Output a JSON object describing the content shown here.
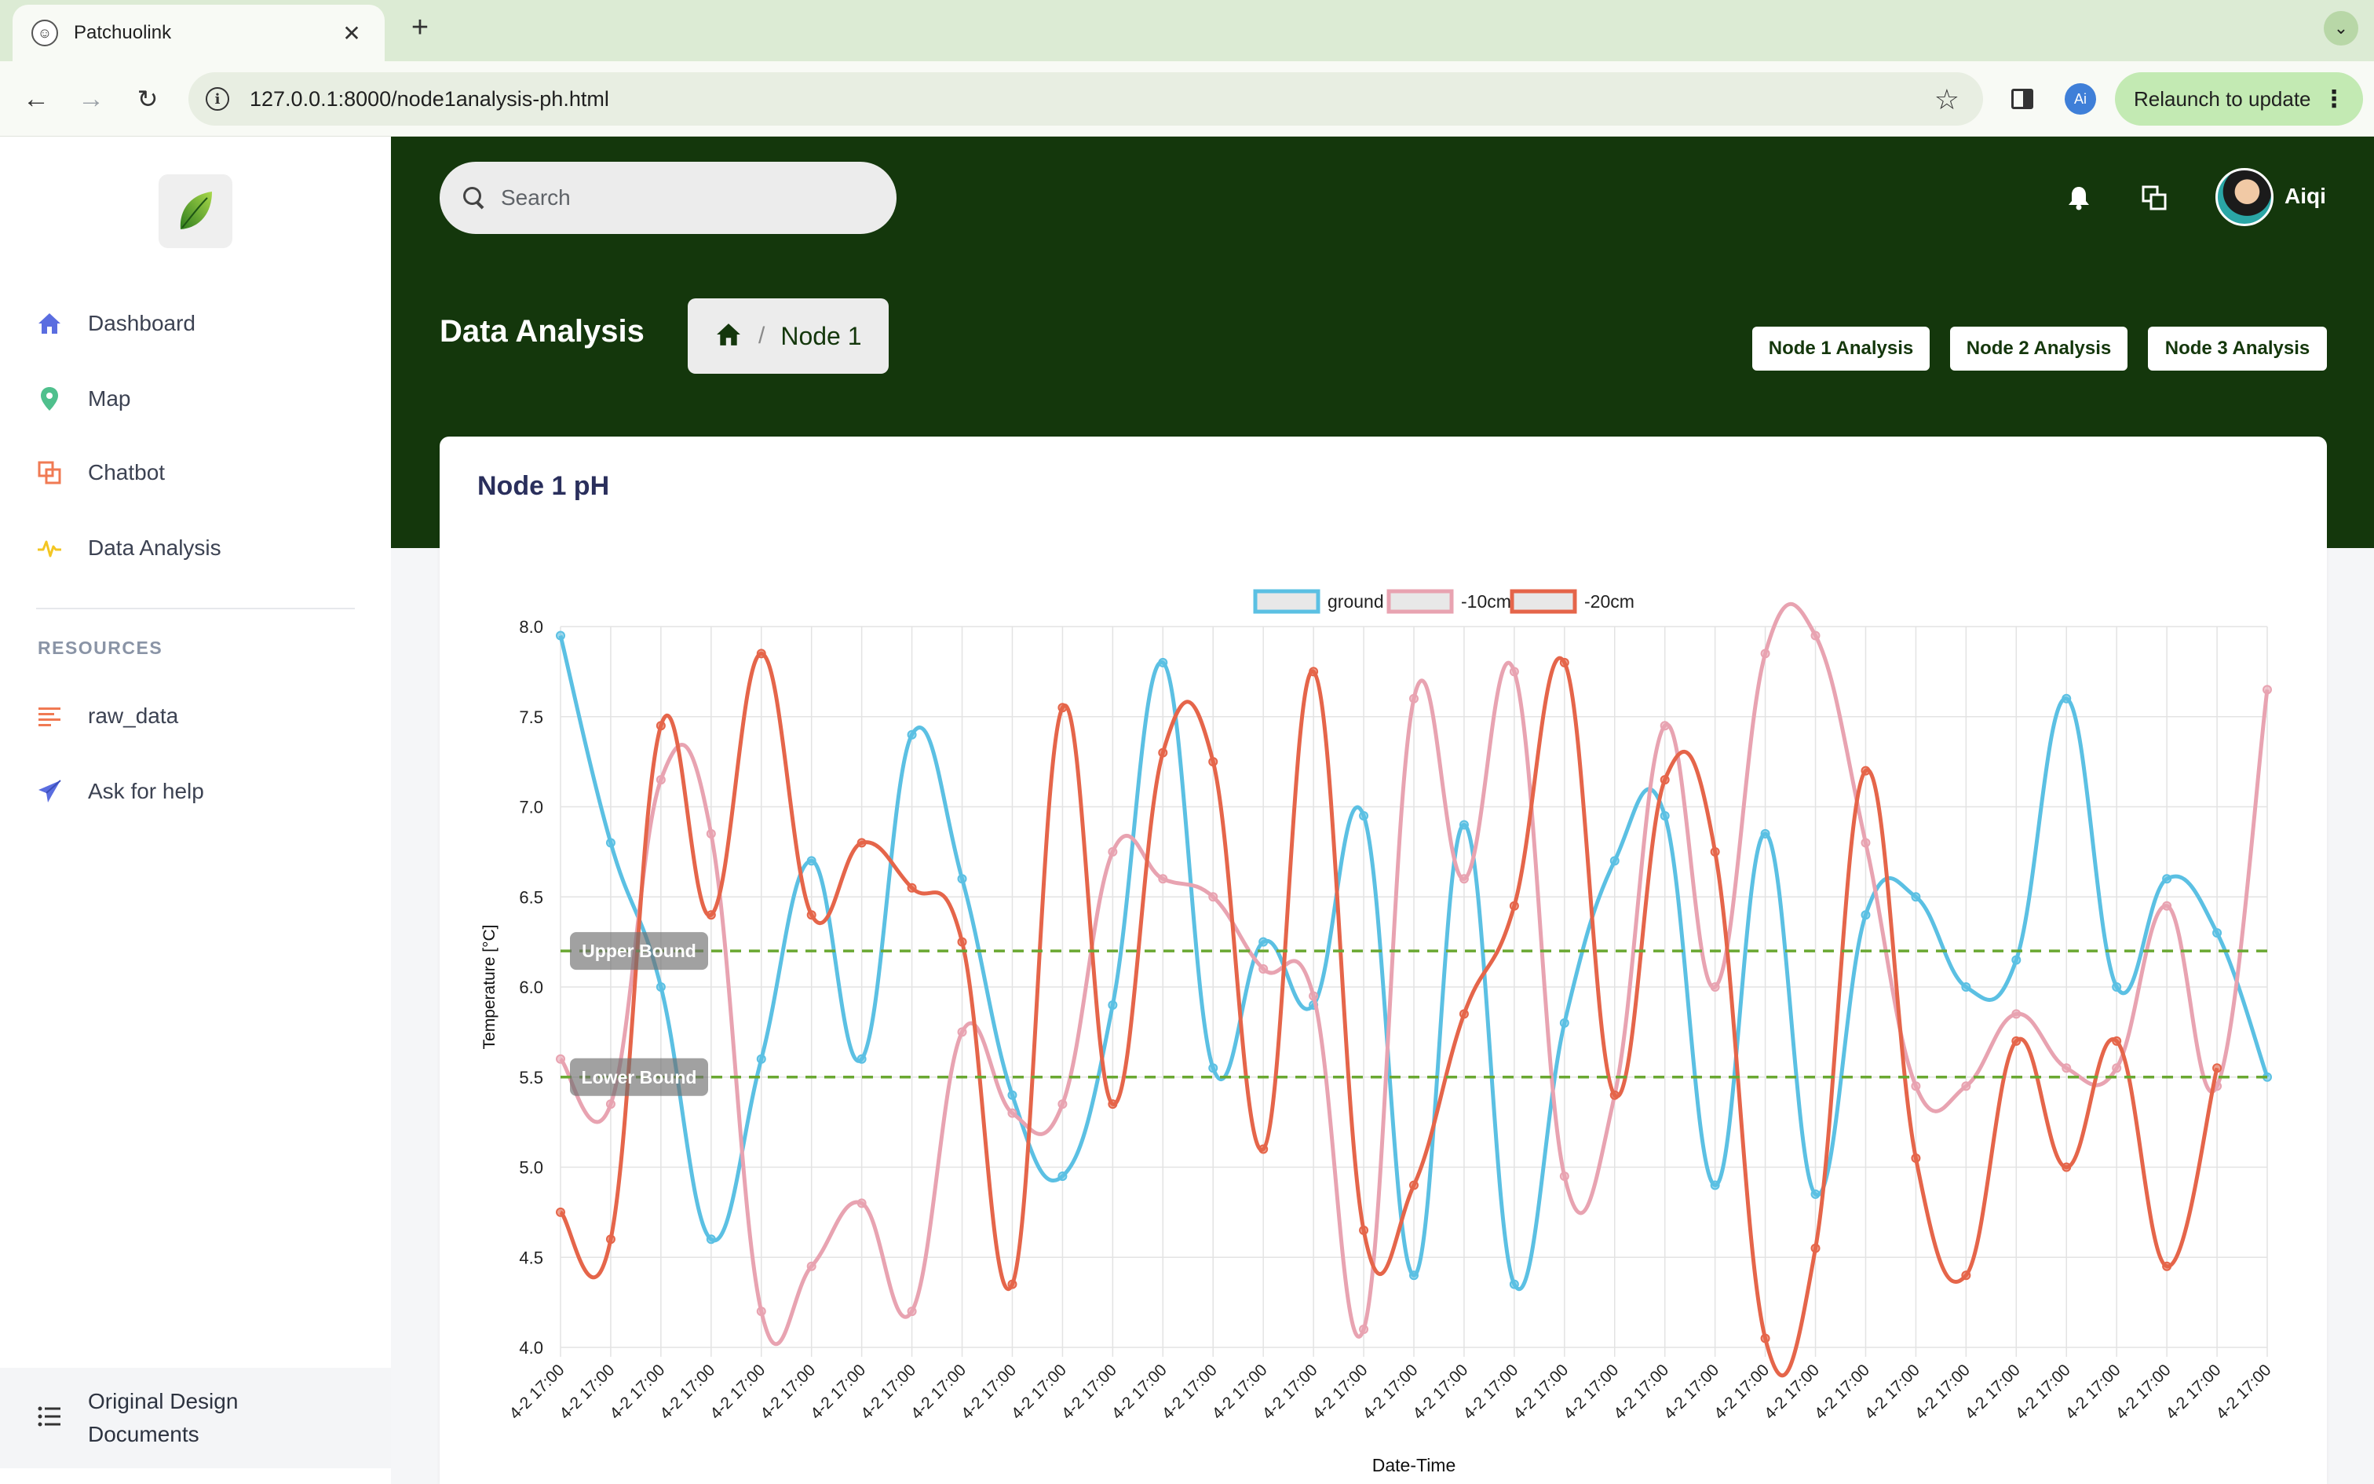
{
  "browser": {
    "tab_title": "Patchuolink",
    "url": "127.0.0.1:8000/node1analysis-ph.html",
    "profile_initials": "Ai",
    "relaunch_label": "Relaunch to update"
  },
  "sidebar": {
    "items": [
      {
        "label": "Dashboard",
        "icon": "home-icon"
      },
      {
        "label": "Map",
        "icon": "map-pin-icon"
      },
      {
        "label": "Chatbot",
        "icon": "chat-icon"
      },
      {
        "label": "Data Analysis",
        "icon": "pulse-icon"
      }
    ],
    "resources_heading": "RESOURCES",
    "resources": [
      {
        "label": "raw_data",
        "icon": "list-lines-icon"
      },
      {
        "label": "Ask for help",
        "icon": "paper-plane-icon"
      }
    ],
    "footer_label": "Original Design Documents"
  },
  "header": {
    "search_placeholder": "Search",
    "username": "Aiqi"
  },
  "page": {
    "title": "Data Analysis",
    "breadcrumb_current": "Node 1",
    "node_buttons": [
      "Node 1 Analysis",
      "Node 2 Analysis",
      "Node 3 Analysis"
    ]
  },
  "card": {
    "title": "Node 1 pH"
  },
  "colors": {
    "header_green": "#14370c",
    "ground": "#5bc0e3",
    "minus10": "#e8a3b1",
    "minus20": "#e5654a",
    "bound_line": "#6aa832"
  },
  "chart_data": {
    "type": "line",
    "xlabel": "Date-Time",
    "ylabel": "Temperature [°C]",
    "ylim": [
      4.0,
      8.0
    ],
    "yticks": [
      "4.0",
      "4.5",
      "5.0",
      "5.5",
      "6.0",
      "6.5",
      "7.0",
      "7.5",
      "8.0"
    ],
    "grid": true,
    "legend_position": "top-center",
    "x": [
      "4-2 17:00",
      "4-2 17:00",
      "4-2 17:00",
      "4-2 17:00",
      "4-2 17:00",
      "4-2 17:00",
      "4-2 17:00",
      "4-2 17:00",
      "4-2 17:00",
      "4-2 17:00",
      "4-2 17:00",
      "4-2 17:00",
      "4-2 17:00",
      "4-2 17:00",
      "4-2 17:00",
      "4-2 17:00",
      "4-2 17:00",
      "4-2 17:00",
      "4-2 17:00",
      "4-2 17:00",
      "4-2 17:00",
      "4-2 17:00",
      "4-2 17:00",
      "4-2 17:00",
      "4-2 17:00",
      "4-2 17:00",
      "4-2 17:00",
      "4-2 17:00",
      "4-2 17:00",
      "4-2 17:00",
      "4-2 17:00",
      "4-2 17:00",
      "4-2 17:00",
      "4-2 17:00",
      "4-2 17:00"
    ],
    "series": [
      {
        "name": "ground",
        "values": [
          7.95,
          6.8,
          6.0,
          4.6,
          5.6,
          6.7,
          5.6,
          7.4,
          6.6,
          5.4,
          4.95,
          5.9,
          7.8,
          5.55,
          6.25,
          5.9,
          6.95,
          4.4,
          6.9,
          4.35,
          5.8,
          6.7,
          6.95,
          4.9,
          6.85,
          4.85,
          6.4,
          6.5,
          6.0,
          6.15,
          7.6,
          6.0,
          6.6,
          6.3,
          5.5
        ]
      },
      {
        "name": "-10cm",
        "values": [
          5.6,
          5.35,
          7.15,
          6.85,
          4.2,
          4.45,
          4.8,
          4.2,
          5.75,
          5.3,
          5.35,
          6.75,
          6.6,
          6.5,
          6.1,
          5.95,
          4.1,
          7.6,
          6.6,
          7.75,
          4.95,
          5.4,
          7.45,
          6.0,
          7.85,
          7.95,
          6.8,
          5.45,
          5.45,
          5.85,
          5.55,
          5.55,
          6.45,
          5.45,
          7.65
        ]
      },
      {
        "name": "-20cm",
        "values": [
          4.75,
          4.6,
          7.45,
          6.4,
          7.85,
          6.4,
          6.8,
          6.55,
          6.25,
          4.35,
          7.55,
          5.35,
          7.3,
          7.25,
          5.1,
          7.75,
          4.65,
          4.9,
          5.85,
          6.45,
          7.8,
          5.4,
          7.15,
          6.75,
          4.05,
          4.55,
          7.2,
          5.05,
          4.4,
          5.7,
          5.0,
          5.7,
          4.45,
          5.55
        ]
      }
    ],
    "annotations": [
      {
        "label": "Upper Bound",
        "value": 6.2
      },
      {
        "label": "Lower Bound",
        "value": 5.5
      }
    ]
  }
}
